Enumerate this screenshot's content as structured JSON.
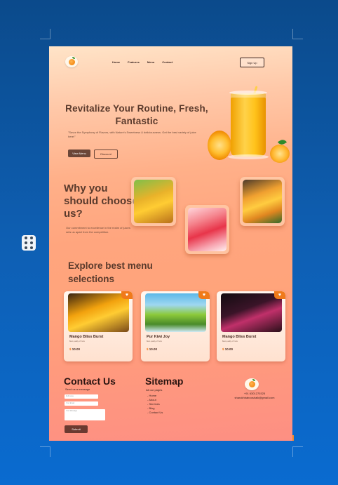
{
  "nav": {
    "items": [
      "Home",
      "Features",
      "Menu",
      "Contact"
    ],
    "signup_label": "Sign Up"
  },
  "hero": {
    "title": "Revitalize Your Routine, Fresh, Fantastic",
    "subtitle": "\"Savor the Symphony of Flavors, with Nature's Sweetness & deliciousness. Get the best variety of juice here!\"",
    "primary_button": "View Menu",
    "secondary_button": "Discount"
  },
  "why": {
    "title": "Why you should choose us?",
    "text": "Our commitment to excellence in the realm of juices sets us apart from the competition."
  },
  "explore": {
    "title": "Explore best menu selections",
    "items": [
      {
        "name": "Mango Bliss Burst",
        "desc": "Best quality of fruits",
        "price": "10.00",
        "currency": "$"
      },
      {
        "name": "Pur Kiwi Joy",
        "desc": "Best quality of fruits",
        "price": "10.00",
        "currency": "$"
      },
      {
        "name": "Mango Bliss Burst",
        "desc": "Best quality of fruits",
        "price": "10.00",
        "currency": "$"
      }
    ]
  },
  "contact": {
    "title": "Contact Us",
    "subtitle": "Send us a message",
    "name_placeholder": "Full name",
    "email_placeholder": "Your Email",
    "message_placeholder": "Your Message",
    "submit_label": "Submit"
  },
  "sitemap": {
    "title": "Sitemap",
    "subtitle": "All our pages",
    "links": [
      "Home",
      "About",
      "Services",
      "Blog",
      "Contact Us"
    ]
  },
  "footer": {
    "phone": "+91 6301270325",
    "email": "sharukhbabooshaik@gmail.com"
  },
  "colors": {
    "accent": "#f07a1a",
    "brown": "#6b4638",
    "background_blue": "#0e5fb3"
  }
}
